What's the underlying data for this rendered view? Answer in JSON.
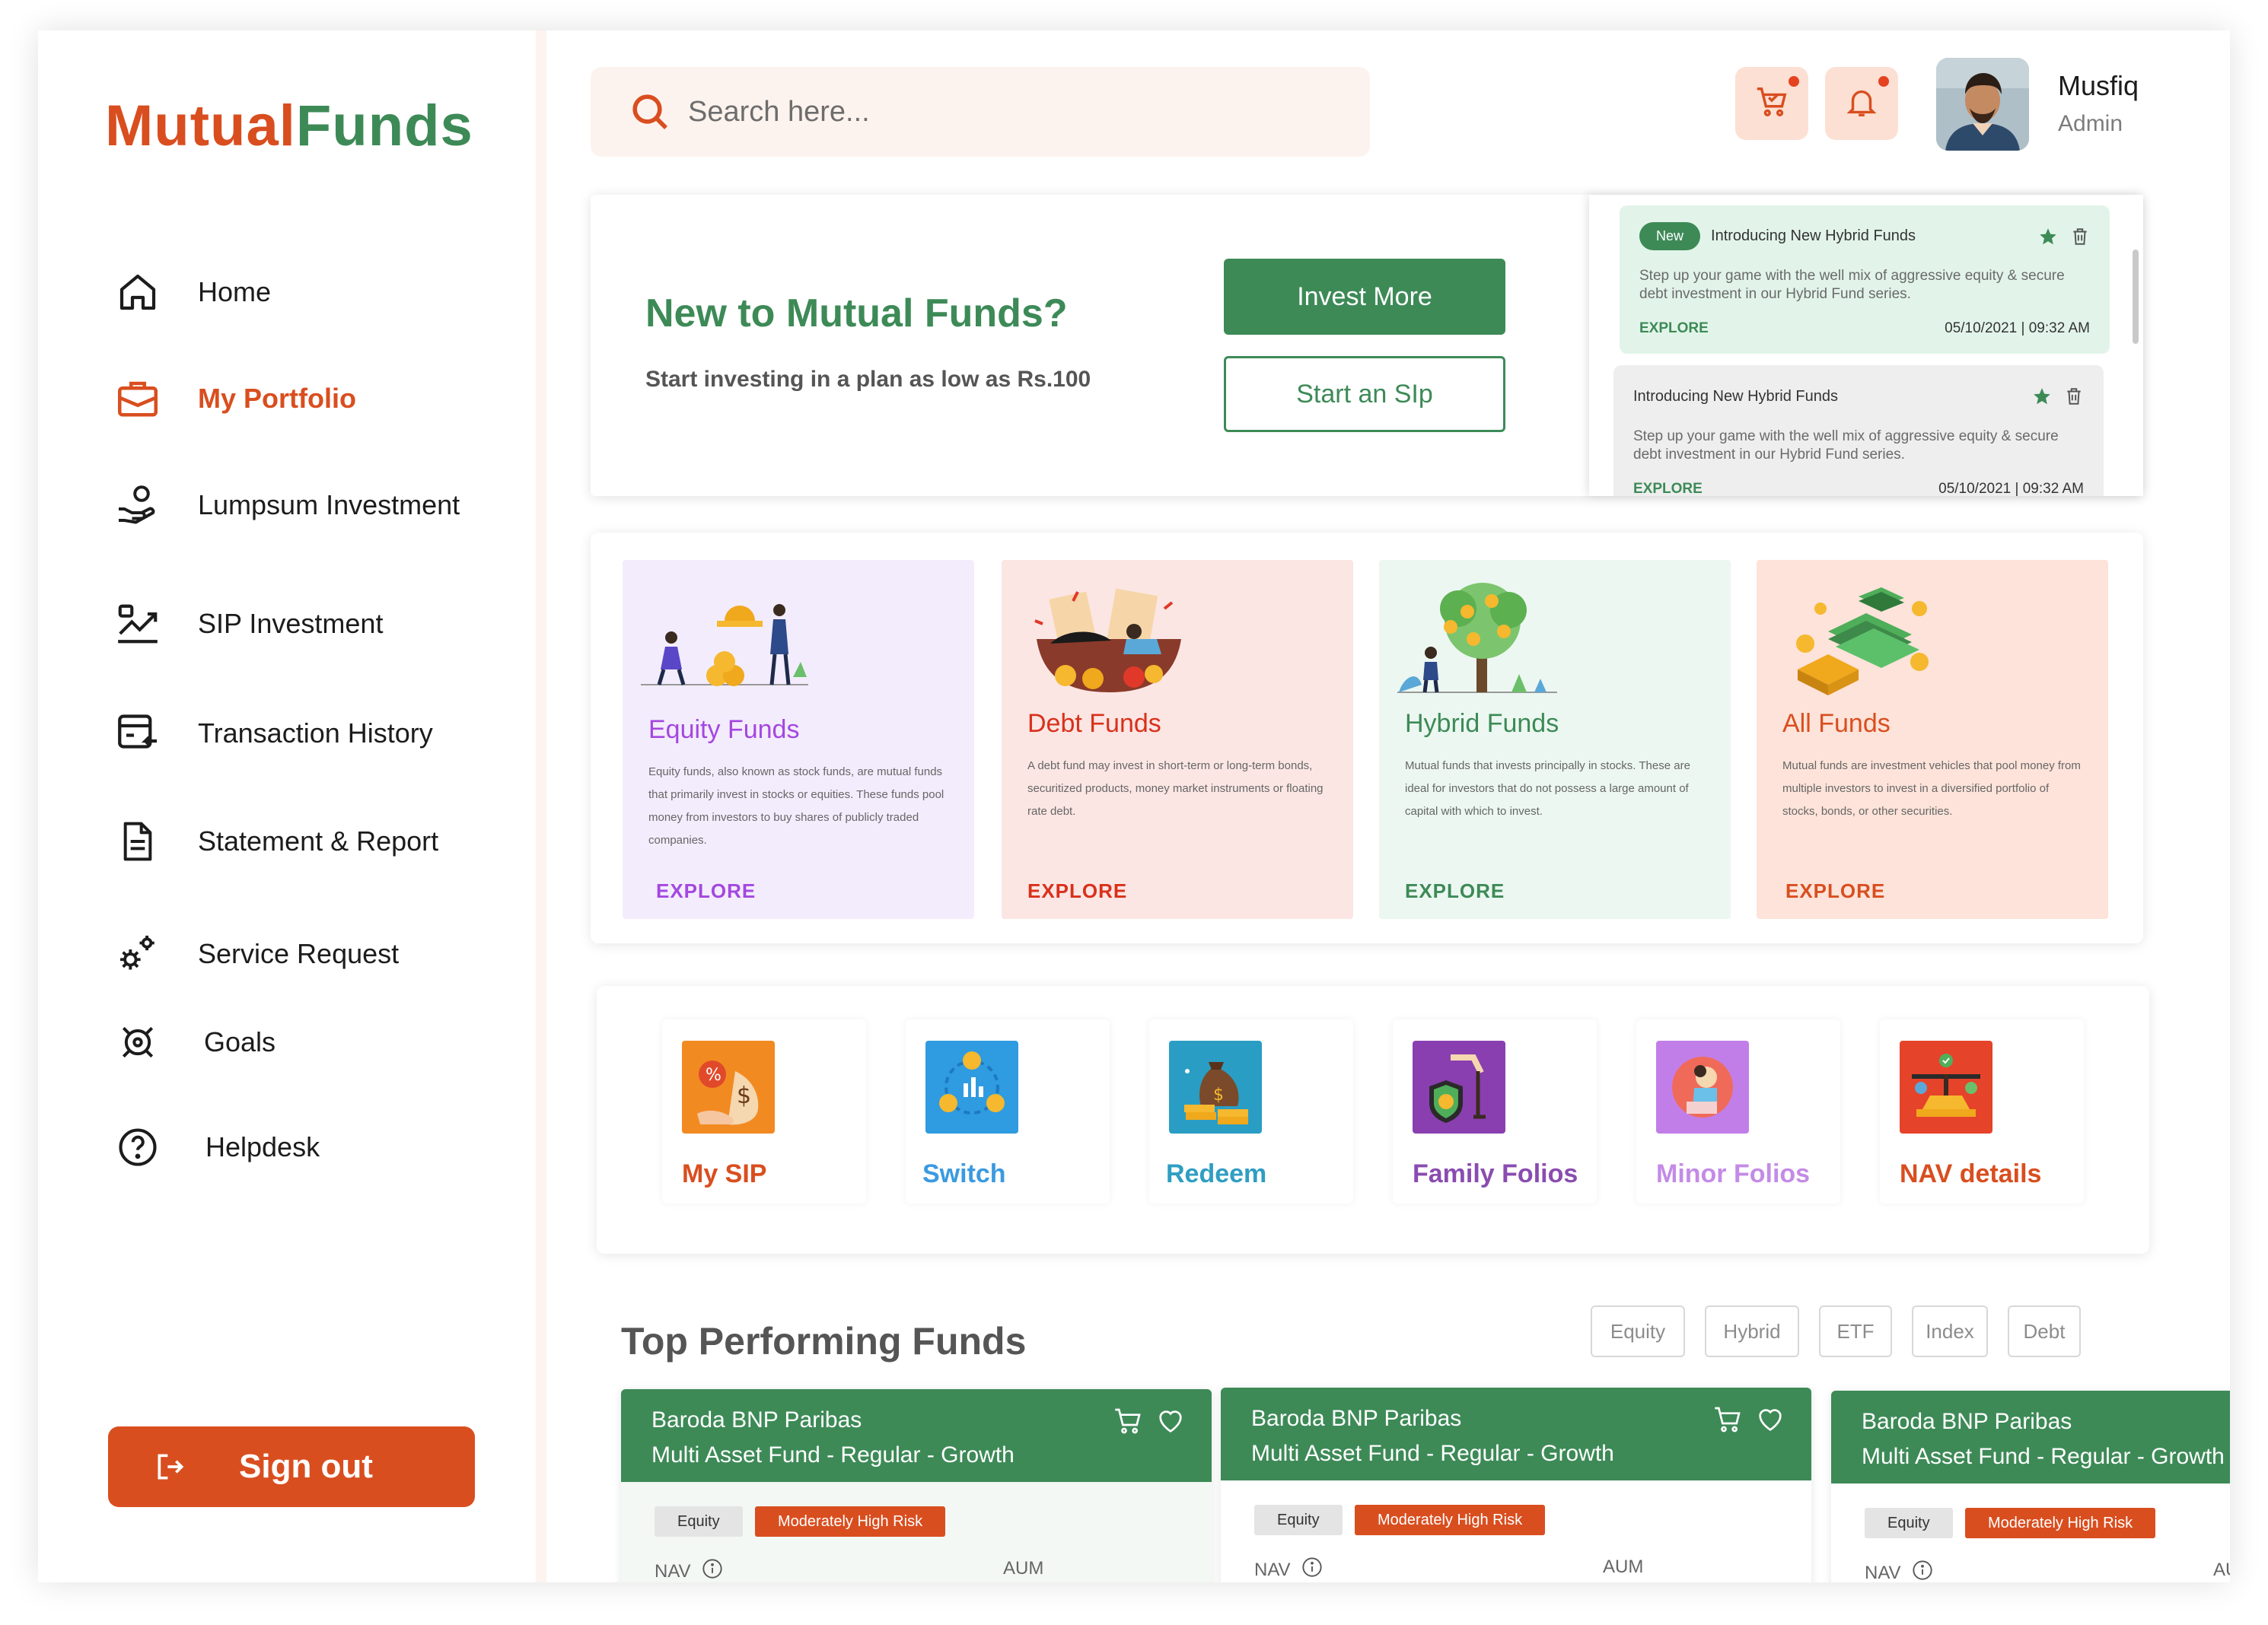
{
  "brand": {
    "part1": "Mutual",
    "part2": "Funds",
    "color1": "#d94e1f",
    "color2": "#3d8a57"
  },
  "sidebar": {
    "items": [
      {
        "label": "Home",
        "icon": "home-icon"
      },
      {
        "label": "My Portfolio",
        "icon": "briefcase-icon",
        "active": true
      },
      {
        "label": "Lumpsum Investment",
        "icon": "hand-coin-icon"
      },
      {
        "label": "SIP Investment",
        "icon": "growth-chart-icon"
      },
      {
        "label": "Transaction History",
        "icon": "card-history-icon"
      },
      {
        "label": "Statement & Report",
        "icon": "document-icon"
      },
      {
        "label": "Service Request",
        "icon": "gears-icon"
      },
      {
        "label": "Goals",
        "icon": "target-icon"
      },
      {
        "label": "Helpdesk",
        "icon": "help-icon"
      }
    ],
    "signout": "Sign out"
  },
  "header": {
    "search_placeholder": "Search here...",
    "user_name": "Musfiq",
    "user_role": "Admin",
    "cart_icon": "cart-icon",
    "bell_icon": "bell-icon"
  },
  "banner": {
    "title": "New to Mutual Funds?",
    "subtitle": "Start investing in a plan as low as Rs.100",
    "invest_button": "Invest More",
    "sip_button": "Start an SIp"
  },
  "notifications": [
    {
      "badge": "New",
      "title": "Introducing New Hybrid Funds",
      "body": "Step up your game with the well mix of aggressive equity & secure debt investment in our Hybrid Fund series.",
      "explore": "EXPLORE",
      "date": "05/10/2021 | 09:32 AM"
    },
    {
      "badge": "",
      "title": "Introducing New Hybrid Funds",
      "body": "Step up your game with the well mix of aggressive equity & secure debt investment in our Hybrid Fund series.",
      "explore": "EXPLORE",
      "date": "05/10/2021 | 09:32 AM"
    }
  ],
  "categories": [
    {
      "name": "Equity Funds",
      "desc": "Equity funds, also known as stock funds, are mutual funds that primarily invest in stocks or equities. These funds pool money from investors to buy shares of publicly traded companies.",
      "explore": "EXPLORE",
      "bg": "#f3ecfd",
      "color": "#a447e0"
    },
    {
      "name": "Debt Funds",
      "desc": "A debt fund may invest in short-term or long-term bonds, securitized products, money market instruments or floating rate debt.",
      "explore": "EXPLORE",
      "bg": "#fbe6e4",
      "color": "#d9301a"
    },
    {
      "name": "Hybrid Funds",
      "desc": "Mutual funds that invests principally in stocks. These are ideal for investors that  do not possess a large amount of capital with which to invest.",
      "explore": "EXPLORE",
      "bg": "#ecf7f1",
      "color": "#3d8a57"
    },
    {
      "name": "All Funds",
      "desc": "Mutual funds are investment vehicles that pool money from multiple investors to invest in a diversified portfolio of stocks, bonds, or other securities.",
      "explore": "EXPLORE",
      "bg": "#fde3d9",
      "color": "#d94e1f"
    }
  ],
  "actions": [
    {
      "label": "My SIP",
      "color": "#d94e1f",
      "icon": "money-bag-percent-icon"
    },
    {
      "label": "Switch",
      "color": "#3b9ae0",
      "icon": "coin-cycle-icon"
    },
    {
      "label": "Redeem",
      "color": "#2f9ec2",
      "icon": "coin-bag-icon"
    },
    {
      "label": "Family Folios",
      "color": "#8a4cb0",
      "icon": "family-shield-icon"
    },
    {
      "label": "Minor Folios",
      "color": "#c48be6",
      "icon": "minor-child-icon"
    },
    {
      "label": "NAV details",
      "color": "#d94e1f",
      "icon": "scale-icon"
    }
  ],
  "top_funds": {
    "title": "Top Performing Funds",
    "filters": [
      "Equity",
      "Hybrid",
      "ETF",
      "Index",
      "Debt"
    ],
    "cards": [
      {
        "line1": "Baroda BNP Paribas",
        "line2": "Multi Asset Fund - Regular - Growth",
        "tag1": "Equity",
        "tag2": "Moderately High Risk",
        "nav": "NAV",
        "aum": "AUM"
      },
      {
        "line1": "Baroda BNP Paribas",
        "line2": "Multi Asset Fund  - Regular - Growth",
        "tag1": "Equity",
        "tag2": "Moderately High Risk",
        "nav": "NAV",
        "aum": "AUM"
      },
      {
        "line1": "Baroda BNP Paribas",
        "line2": "Multi Asset Fund  - Regular - Growth",
        "tag1": "Equity",
        "tag2": "Moderately High Risk",
        "nav": "NAV",
        "aum": "AUM"
      }
    ]
  }
}
